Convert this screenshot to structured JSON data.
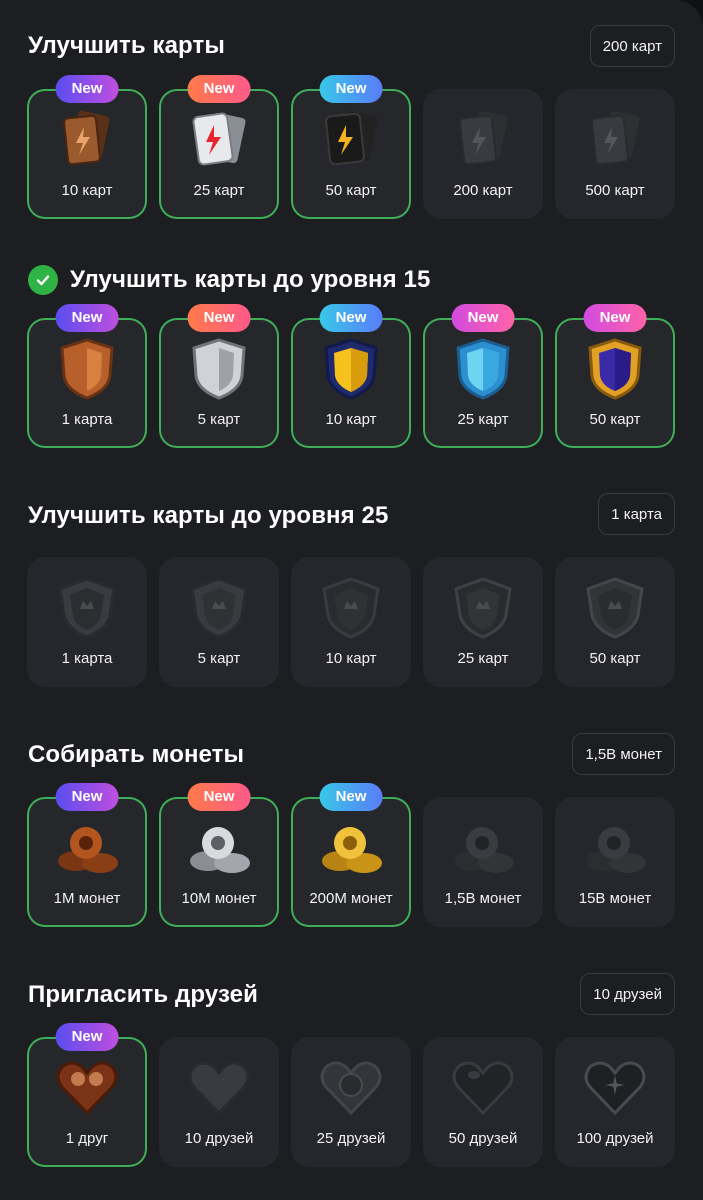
{
  "sections": [
    {
      "title": "Улучшить карты",
      "pill": "200 карт",
      "tiles": [
        {
          "label": "10 карт",
          "badge": "New",
          "icon": "bronze-cards-icon"
        },
        {
          "label": "25 карт",
          "badge": "New",
          "icon": "silver-cards-icon"
        },
        {
          "label": "50 карт",
          "badge": "New",
          "icon": "gold-cards-icon"
        },
        {
          "label": "200 карт",
          "badge": "",
          "icon": "locked-cards-icon"
        },
        {
          "label": "500 карт",
          "badge": "",
          "icon": "locked-cards-icon"
        }
      ]
    },
    {
      "title": "Улучшить карты до уровня 15",
      "completed": true,
      "tiles": [
        {
          "label": "1 карта",
          "badge": "New",
          "icon": "bronze-shield-icon"
        },
        {
          "label": "5 карт",
          "badge": "New",
          "icon": "silver-shield-icon"
        },
        {
          "label": "10 карт",
          "badge": "New",
          "icon": "gold-shield-icon"
        },
        {
          "label": "25 карт",
          "badge": "New",
          "icon": "diamond-shield-icon"
        },
        {
          "label": "50 карт",
          "badge": "New",
          "icon": "sapphire-shield-icon"
        }
      ]
    },
    {
      "title": "Улучшить карты до уровня 25",
      "pill": "1 карта",
      "tiles": [
        {
          "label": "1 карта",
          "badge": "",
          "icon": "locked-shield-icon"
        },
        {
          "label": "5 карт",
          "badge": "",
          "icon": "locked-shield-icon"
        },
        {
          "label": "10 карт",
          "badge": "",
          "icon": "locked-shield-icon"
        },
        {
          "label": "25 карт",
          "badge": "",
          "icon": "locked-shield-icon"
        },
        {
          "label": "50 карт",
          "badge": "",
          "icon": "locked-shield-icon"
        }
      ]
    },
    {
      "title": "Собирать монеты",
      "pill": "1,5B монет",
      "tiles": [
        {
          "label": "1M монет",
          "badge": "New",
          "icon": "bronze-coins-icon"
        },
        {
          "label": "10M монет",
          "badge": "New",
          "icon": "silver-coins-icon"
        },
        {
          "label": "200M монет",
          "badge": "New",
          "icon": "gold-coins-icon"
        },
        {
          "label": "1,5B монет",
          "badge": "",
          "icon": "locked-coins-icon"
        },
        {
          "label": "15B монет",
          "badge": "",
          "icon": "locked-coins-icon"
        }
      ]
    },
    {
      "title": "Пригласить друзей",
      "pill": "10 друзей",
      "tiles": [
        {
          "label": "1 друг",
          "badge": "New",
          "icon": "bronze-heart-icon"
        },
        {
          "label": "10 друзей",
          "badge": "",
          "icon": "locked-heart-icon"
        },
        {
          "label": "25 друзей",
          "badge": "",
          "icon": "locked-heart-icon"
        },
        {
          "label": "50 друзей",
          "badge": "",
          "icon": "locked-heart-icon"
        },
        {
          "label": "100 друзей",
          "badge": "",
          "icon": "locked-heart-icon"
        }
      ]
    }
  ],
  "colors": {
    "panel": "#1d1e22",
    "tile": "#26272c",
    "completed_border": "#3fae58",
    "check": "#2fb344"
  }
}
